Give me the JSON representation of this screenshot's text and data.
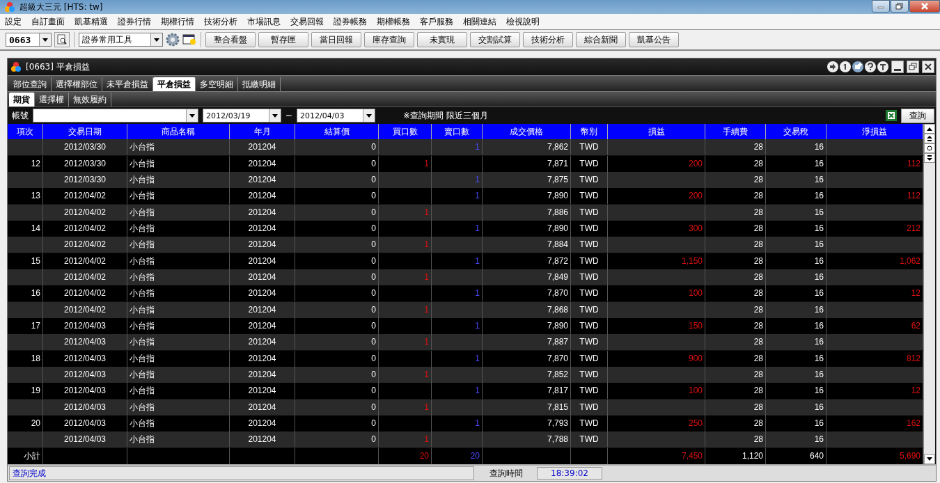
{
  "window": {
    "title": "超級大三元  [HTS: tw]"
  },
  "menu": [
    "設定",
    "自訂畫面",
    "凱基精選",
    "證券行情",
    "期權行情",
    "技術分析",
    "市場訊息",
    "交易回報",
    "證券帳務",
    "期權帳務",
    "客戶服務",
    "相關連結",
    "檢視說明"
  ],
  "toolbar": {
    "code": "0663",
    "tool_select": "證券常用工具",
    "buttons": [
      "整合看盤",
      "暫存匣",
      "當日回報",
      "庫存查詢",
      "未實現",
      "交割試算",
      "技術分析",
      "綜合新聞",
      "凱基公告"
    ]
  },
  "panel": {
    "title": "[0663] 平倉損益",
    "tabs": [
      {
        "label": "部位查詢",
        "selected": false
      },
      {
        "label": "選擇權部位",
        "selected": false
      },
      {
        "label": "未平倉損益",
        "selected": false
      },
      {
        "label": "平倉損益",
        "selected": true
      },
      {
        "label": "多空明細",
        "selected": false
      },
      {
        "label": "抵繳明細",
        "selected": false
      }
    ],
    "subtabs": [
      {
        "label": "期貨",
        "selected": true
      },
      {
        "label": "選擇權",
        "selected": false
      },
      {
        "label": "無效履約",
        "selected": false
      }
    ],
    "filter": {
      "account_label": "帳號",
      "date_from": "2012/03/19",
      "separator": "~",
      "date_to": "2012/04/03",
      "note": "※查詢期間 限近三個月",
      "query_button": "查詢"
    },
    "table": {
      "columns": [
        "項次",
        "交易日期",
        "商品名稱",
        "年月",
        "結算價",
        "買口數",
        "賣口數",
        "成交價格",
        "幣別",
        "損益",
        "手續費",
        "交易稅",
        "淨損益"
      ],
      "rows": [
        {
          "date": "2012/03/30",
          "product": "小台指",
          "month": "201204",
          "settle": "0",
          "sell": "1",
          "price": "7,862",
          "currency": "TWD",
          "fee": "28",
          "tax": "16"
        },
        {
          "no": "12",
          "date": "2012/03/30",
          "product": "小台指",
          "month": "201204",
          "settle": "0",
          "buy": "1",
          "price": "7,871",
          "currency": "TWD",
          "pnl": "200",
          "fee": "28",
          "tax": "16",
          "net": "112"
        },
        {
          "date": "2012/03/30",
          "product": "小台指",
          "month": "201204",
          "settle": "0",
          "sell": "1",
          "price": "7,875",
          "currency": "TWD",
          "fee": "28",
          "tax": "16"
        },
        {
          "no": "13",
          "date": "2012/04/02",
          "product": "小台指",
          "month": "201204",
          "settle": "0",
          "sell": "1",
          "price": "7,890",
          "currency": "TWD",
          "pnl": "200",
          "fee": "28",
          "tax": "16",
          "net": "112"
        },
        {
          "date": "2012/04/02",
          "product": "小台指",
          "month": "201204",
          "settle": "0",
          "buy": "1",
          "price": "7,886",
          "currency": "TWD",
          "fee": "28",
          "tax": "16"
        },
        {
          "no": "14",
          "date": "2012/04/02",
          "product": "小台指",
          "month": "201204",
          "settle": "0",
          "sell": "1",
          "price": "7,890",
          "currency": "TWD",
          "pnl": "300",
          "fee": "28",
          "tax": "16",
          "net": "212"
        },
        {
          "date": "2012/04/02",
          "product": "小台指",
          "month": "201204",
          "settle": "0",
          "buy": "1",
          "price": "7,884",
          "currency": "TWD",
          "fee": "28",
          "tax": "16"
        },
        {
          "no": "15",
          "date": "2012/04/02",
          "product": "小台指",
          "month": "201204",
          "settle": "0",
          "sell": "1",
          "price": "7,872",
          "currency": "TWD",
          "pnl": "1,150",
          "fee": "28",
          "tax": "16",
          "net": "1,062"
        },
        {
          "date": "2012/04/02",
          "product": "小台指",
          "month": "201204",
          "settle": "0",
          "buy": "1",
          "price": "7,849",
          "currency": "TWD",
          "fee": "28",
          "tax": "16"
        },
        {
          "no": "16",
          "date": "2012/04/02",
          "product": "小台指",
          "month": "201204",
          "settle": "0",
          "sell": "1",
          "price": "7,870",
          "currency": "TWD",
          "pnl": "100",
          "fee": "28",
          "tax": "16",
          "net": "12"
        },
        {
          "date": "2012/04/02",
          "product": "小台指",
          "month": "201204",
          "settle": "0",
          "buy": "1",
          "price": "7,868",
          "currency": "TWD",
          "fee": "28",
          "tax": "16"
        },
        {
          "no": "17",
          "date": "2012/04/03",
          "product": "小台指",
          "month": "201204",
          "settle": "0",
          "sell": "1",
          "price": "7,890",
          "currency": "TWD",
          "pnl": "150",
          "fee": "28",
          "tax": "16",
          "net": "62"
        },
        {
          "date": "2012/04/03",
          "product": "小台指",
          "month": "201204",
          "settle": "0",
          "buy": "1",
          "price": "7,887",
          "currency": "TWD",
          "fee": "28",
          "tax": "16"
        },
        {
          "no": "18",
          "date": "2012/04/03",
          "product": "小台指",
          "month": "201204",
          "settle": "0",
          "sell": "1",
          "price": "7,870",
          "currency": "TWD",
          "pnl": "900",
          "fee": "28",
          "tax": "16",
          "net": "812"
        },
        {
          "date": "2012/04/03",
          "product": "小台指",
          "month": "201204",
          "settle": "0",
          "buy": "1",
          "price": "7,852",
          "currency": "TWD",
          "fee": "28",
          "tax": "16"
        },
        {
          "no": "19",
          "date": "2012/04/03",
          "product": "小台指",
          "month": "201204",
          "settle": "0",
          "sell": "1",
          "price": "7,817",
          "currency": "TWD",
          "pnl": "100",
          "fee": "28",
          "tax": "16",
          "net": "12"
        },
        {
          "date": "2012/04/03",
          "product": "小台指",
          "month": "201204",
          "settle": "0",
          "buy": "1",
          "price": "7,815",
          "currency": "TWD",
          "fee": "28",
          "tax": "16"
        },
        {
          "no": "20",
          "date": "2012/04/03",
          "product": "小台指",
          "month": "201204",
          "settle": "0",
          "sell": "1",
          "price": "7,793",
          "currency": "TWD",
          "pnl": "250",
          "fee": "28",
          "tax": "16",
          "net": "162"
        },
        {
          "date": "2012/04/03",
          "product": "小台指",
          "month": "201204",
          "settle": "0",
          "buy": "1",
          "price": "7,788",
          "currency": "TWD",
          "fee": "28",
          "tax": "16"
        }
      ],
      "subtotal": {
        "no": "小計",
        "buy": "20",
        "sell": "20",
        "pnl": "7,450",
        "fee": "1,120",
        "tax": "640",
        "net": "5,690"
      }
    },
    "status_bar": {
      "message": "查詢完成",
      "time_label": "查詢時間",
      "time": "18:39:02"
    }
  }
}
